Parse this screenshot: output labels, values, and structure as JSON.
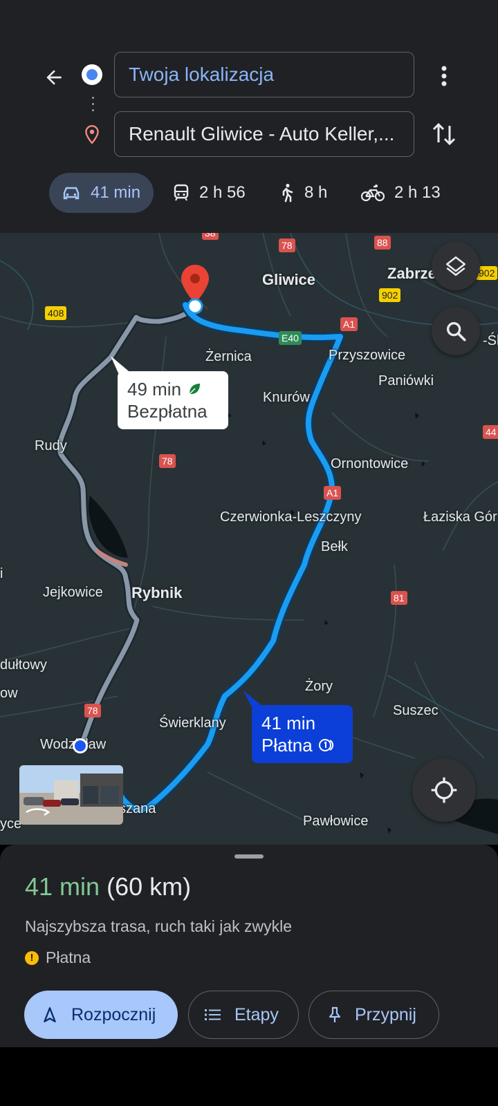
{
  "search": {
    "origin_value": "Twoja lokalizacja",
    "destination_value": "Renault Gliwice - Auto Keller,..."
  },
  "travel_modes": [
    {
      "mode": "car",
      "icon": "car-icon",
      "label": "41 min",
      "selected": true
    },
    {
      "mode": "transit",
      "icon": "train-icon",
      "label": "2 h 56",
      "selected": false
    },
    {
      "mode": "walk",
      "icon": "walk-icon",
      "label": "8 h",
      "selected": false
    },
    {
      "mode": "bike",
      "icon": "bike-icon",
      "label": "2 h 13",
      "selected": false
    }
  ],
  "map": {
    "places": [
      "Gliwice",
      "Zabrze",
      "Żernica",
      "Przyszowice",
      "Paniówki",
      "Knurów",
      "Rudy",
      "Ornontowice",
      "Czerwionka-Leszczyny",
      "Łaziska Gór",
      "Bełk",
      "Jejkowice",
      "Rybnik",
      "dułtowy",
      "ow",
      "Żory",
      "Suszec",
      "Świerklany",
      "Wodzisław",
      "szana",
      "Pawłowice",
      "yce",
      "i",
      "-Śl"
    ],
    "road_shields": [
      "78",
      "88",
      "902",
      "902",
      "408",
      "E40",
      "A1",
      "A1",
      "78",
      "81",
      "78",
      "44",
      "38"
    ],
    "alt_route": {
      "time": "49 min",
      "note": "Bezpłatna",
      "icon": "leaf-icon"
    },
    "main_route": {
      "time": "41 min",
      "note": "Płatna",
      "icon": "toll-info-icon"
    },
    "colors": {
      "main_route": "#1a9cf0",
      "alt_route": "#8a97a6",
      "destination_pin": "#ea4335"
    }
  },
  "sheet": {
    "time": "41 min",
    "distance": "(60 km)",
    "description": "Najszybsza trasa, ruch taki jak zwykle",
    "toll_label": "Płatna",
    "buttons": {
      "start": "Rozpocznij",
      "steps": "Etapy",
      "pin": "Przypnij"
    }
  }
}
